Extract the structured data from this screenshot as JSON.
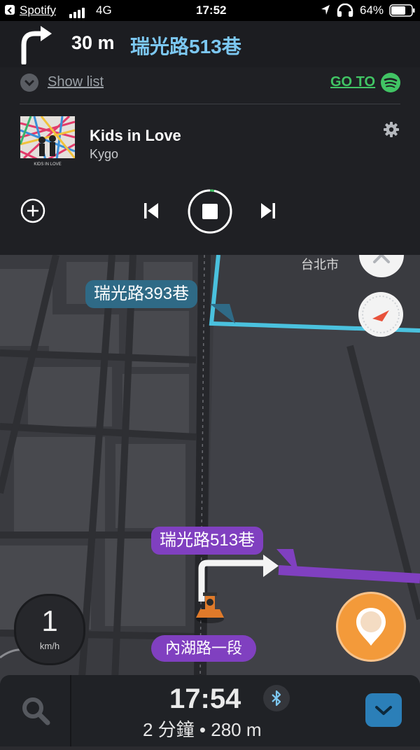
{
  "status_bar": {
    "back_app": "Spotify",
    "network": "4G",
    "time": "17:52",
    "battery": "64%"
  },
  "navigation": {
    "distance": "30 m",
    "street": "瑞光路513巷",
    "turn_icon": "turn-right-arrow"
  },
  "spotify": {
    "show_list_label": "Show list",
    "goto_label": "GO TO",
    "track_title": "Kids in Love",
    "artist": "Kygo",
    "album_art_text": "KIDS IN LOVE"
  },
  "map": {
    "labels": {
      "lane_393": "瑞光路393巷",
      "lane_513": "瑞光路513巷",
      "current_road": "內湖路一段",
      "area_label": "台北市"
    },
    "speed": {
      "value": "1",
      "unit": "km/h"
    }
  },
  "trip": {
    "eta": "17:54",
    "summary": "2 分鐘 • 280 m"
  },
  "colors": {
    "accent_blue": "#7cc7f1",
    "route_purple": "#8040c0",
    "spotify_green": "#41c464",
    "route_cyan": "#4dd0f0"
  }
}
